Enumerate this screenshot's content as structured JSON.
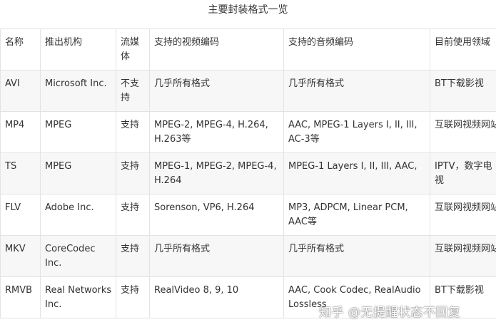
{
  "caption": "主要封装格式一览",
  "table": {
    "headers": [
      "名称",
      "推出机构",
      "流媒体",
      "支持的视频编码",
      "支持的音频编码",
      "目前使用领域"
    ],
    "rows": [
      [
        "AVI",
        "Microsoft Inc.",
        "不支持",
        "几乎所有格式",
        "几乎所有格式",
        "BT下载影视"
      ],
      [
        "MP4",
        "MPEG",
        "支持",
        "MPEG-2, MPEG-4, H.264, H.263等",
        "AAC, MPEG-1 Layers I, II, III, AC-3等",
        "互联网视频网站"
      ],
      [
        "TS",
        "MPEG",
        "支持",
        "MPEG-1, MPEG-2, MPEG-4, H.264",
        "MPEG-1 Layers I, II, III, AAC,",
        "IPTV，数字电视"
      ],
      [
        "FLV",
        "Adobe Inc.",
        "支持",
        "Sorenson, VP6, H.264",
        "MP3, ADPCM, Linear PCM, AAC等",
        "互联网视频网站"
      ],
      [
        "MKV",
        "CoreCodec Inc.",
        "支持",
        "几乎所有格式",
        "几乎所有格式",
        "互联网视频网站"
      ],
      [
        "RMVB",
        "Real Networks Inc.",
        "支持",
        "RealVideo 8, 9, 10",
        "AAC, Cook Codec, RealAudio Lossless",
        "BT下载影视"
      ]
    ]
  },
  "watermark": "知乎 @无提醒状态不回复"
}
